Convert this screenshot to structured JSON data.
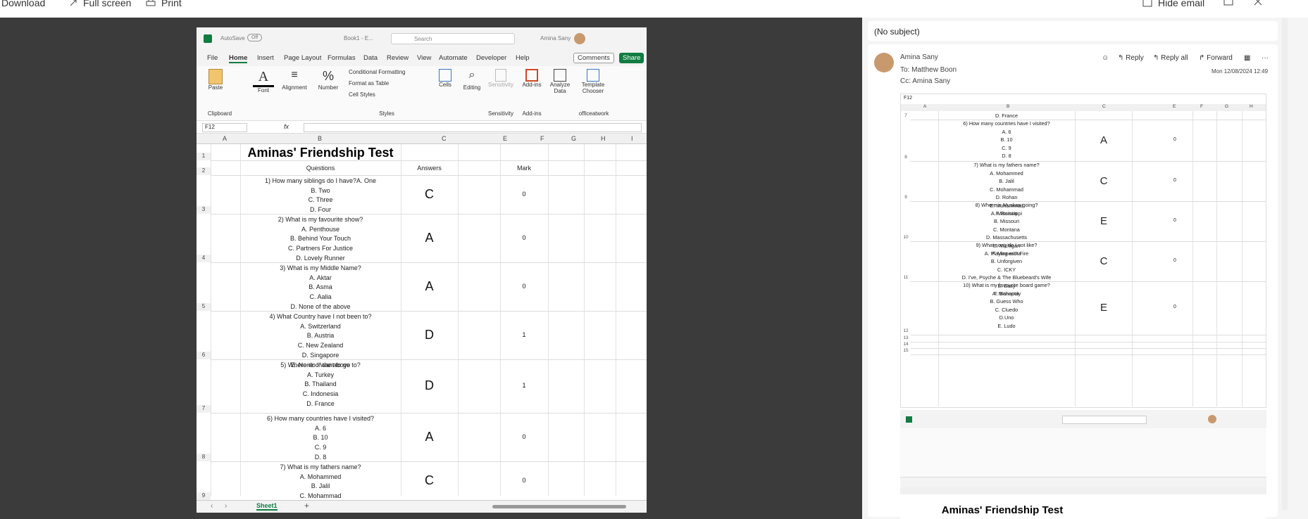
{
  "toolbar": {
    "download": "Download",
    "fullscreen": "Full screen",
    "print": "Print",
    "hide_email": "Hide email"
  },
  "excel": {
    "autosave": "AutoSave",
    "autosave_state": "Off",
    "book": "Book1 - E...",
    "search": "Search",
    "user": "Amina Sany",
    "menu": [
      "File",
      "Home",
      "Insert",
      "Page Layout",
      "Formulas",
      "Data",
      "Review",
      "View",
      "Automate",
      "Developer",
      "Help"
    ],
    "comments": "Comments",
    "share": "Share",
    "ribbon": {
      "paste": "Paste",
      "clipboard": "Clipboard",
      "font": "Font",
      "alignment": "Alignment",
      "number": "Number",
      "cond_fmt": "Conditional Formatting",
      "fmt_table": "Format as Table",
      "cell_styles": "Cell Styles",
      "styles": "Styles",
      "cells": "Cells",
      "editing": "Editing",
      "sensitivity": "Sensitivity",
      "sensitivity_grp": "Sensitivity",
      "addins": "Add-ins",
      "addins_grp": "Add-ins",
      "analyze": "Analyze Data",
      "template": "Template Chooser",
      "officeatwork": "officeatwork"
    },
    "namebox": "F12",
    "fx": "fx",
    "cols": [
      "A",
      "B",
      "C",
      "E",
      "F",
      "G",
      "H",
      "I"
    ],
    "title": "Aminas' Friendship Test",
    "headers": {
      "q": "Questions",
      "a": "Answers",
      "m": "Mark"
    },
    "rows": [
      {
        "n": "1"
      },
      {
        "n": "2"
      },
      {
        "n": "3",
        "q": "1) How many siblings do I have?A. One\nB. Two\nC. Three\nD. Four",
        "a": "C",
        "m": "0"
      },
      {
        "n": "4",
        "q": "2) What is my favourite show?\nA. Penthouse\nB. Behind Your Touch\nC. Partners For Justice\nD. Lovely Runner",
        "a": "A",
        "m": "0"
      },
      {
        "n": "5",
        "q": "3) What is my Middle Name?\nA. Aktar\nB. Asma\nC. Aalia\nD. None of the above",
        "a": "A",
        "m": "0"
      },
      {
        "n": "6",
        "q": "4) What Country have I not been to?\nA. Switzerland\nB. Austria\nC. New Zealand\nD. Singapore\nE. None of the above",
        "a": "D",
        "m": "1"
      },
      {
        "n": "7",
        "q": "5) Where do I want to go to?\nA. Turkey\nB. Thailand\nC. Indonesia\nD. France",
        "a": "D",
        "m": "1"
      },
      {
        "n": "8",
        "q": "6) How many countries have I visited?\nA. 6\nB. 10\nC. 9\nD. 8",
        "a": "A",
        "m": "0"
      },
      {
        "n": "9",
        "q": "7)  What is my fathers name?\nA. Mohammed\nB. Jalil\nC. Mohammad",
        "a": "C",
        "m": "0"
      }
    ],
    "sheet": "Sheet1"
  },
  "email": {
    "subject": "(No subject)",
    "from": "Amina Sany",
    "to_label": "To:",
    "to": "Matthew Boon",
    "cc_label": "Cc:",
    "cc": "Amina Sany",
    "reply": "Reply",
    "reply_all": "Reply all",
    "forward": "Forward",
    "date": "Mon 12/08/2024 12:49"
  },
  "attach": {
    "namebox": "F12",
    "cols": [
      "A",
      "B",
      "C",
      "E",
      "F",
      "G",
      "H"
    ],
    "rows": [
      {
        "n": "7",
        "q": "D. France",
        "a": "",
        "m": ""
      },
      {
        "n": "8",
        "q": "6) How many countries have I visited?\nA. 6\nB. 10\nC. 9\nD. 8",
        "a": "A",
        "m": "0"
      },
      {
        "n": "9",
        "q": "7)  What is my fathers name?\nA. Mohammed\nB. Jalil\nC. Mohammad\nD. Rohan\nE. Muhammad\nF. Romim",
        "a": "C",
        "m": "0"
      },
      {
        "n": "10",
        "q": "8) Where is Muskan going?\nA. Mississippi\nB. Missouri\nC. Montana\nD. Massachusetts\nE. Michigan\nF. Minnesota",
        "a": "E",
        "m": "0"
      },
      {
        "n": "11",
        "q": "9) What song do I not like?\nA. Playing with Fire\nB. Unforgiven\nC. ICKY\nD. I've, Psyche & The Bluebeard's Wife\nE. Easy\nF. Bahama",
        "a": "C",
        "m": "0"
      },
      {
        "n": "12",
        "q": "10) What is my favourite board game?\nA. Monopoly\nB. Guess Who\nC. Cluedo\nD.Uno\nE. Ludo",
        "a": "E",
        "m": "0"
      },
      {
        "n": "13"
      },
      {
        "n": "14"
      },
      {
        "n": "15"
      }
    ],
    "mini_title": "Aminas' Friendship Test"
  },
  "colors": {
    "excel_green": "#107c41",
    "accent": "#0f6cbd"
  }
}
